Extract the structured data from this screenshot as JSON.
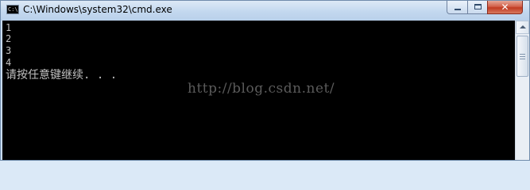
{
  "window": {
    "title": "C:\\Windows\\system32\\cmd.exe",
    "icon": "cmd-console-icon",
    "icon_label": "C:\\",
    "controls": {
      "minimize_icon": "minimize-icon",
      "maximize_icon": "maximize-icon",
      "close_icon": "close-icon",
      "close_glyph": "✕"
    }
  },
  "console": {
    "lines": [
      "1",
      "2",
      "3",
      "4",
      "请按任意键继续. . ."
    ],
    "background": "#000000",
    "text_color": "#c0c0c0"
  },
  "watermark": "http://blog.csdn.net/",
  "colors": {
    "title_bar": "#c3d8ef",
    "close_button": "#c03a22"
  }
}
